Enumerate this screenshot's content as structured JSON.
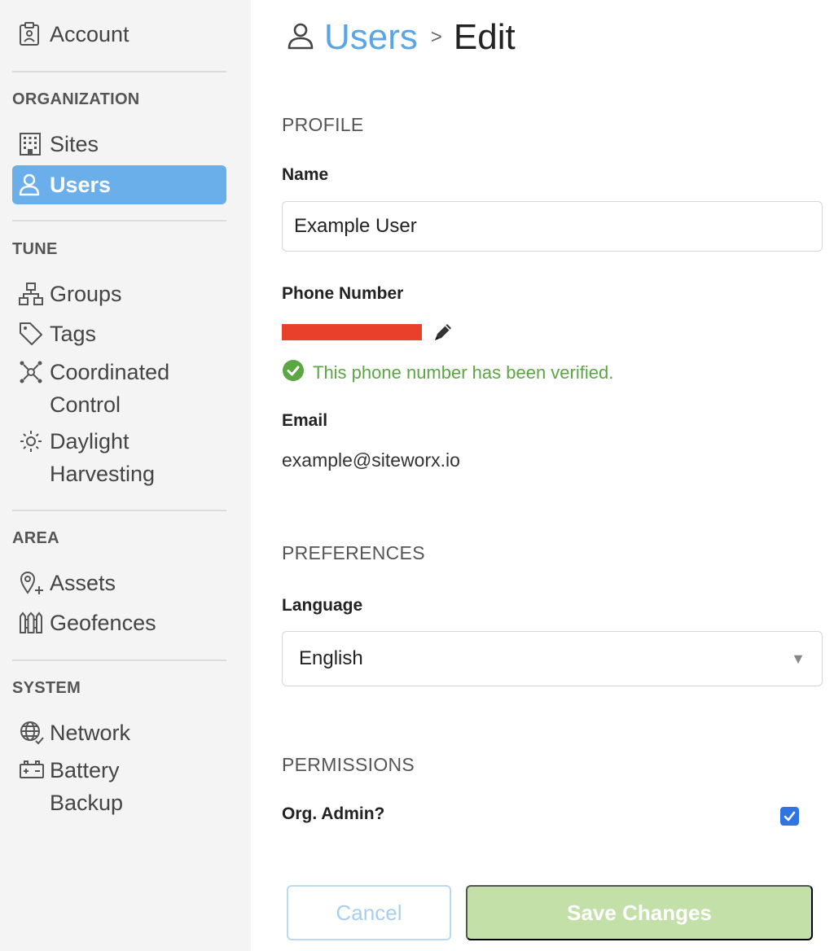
{
  "sidebar": {
    "account": {
      "label": "Account",
      "icon": "clipboard-user-icon"
    },
    "sections": {
      "organization": "ORGANIZATION",
      "tune": "TUNE",
      "area": "AREA",
      "system": "SYSTEM"
    },
    "items": {
      "sites": {
        "label": "Sites",
        "icon": "building-icon"
      },
      "users": {
        "label": "Users",
        "icon": "user-icon",
        "active": true
      },
      "groups": {
        "label": "Groups",
        "icon": "hierarchy-icon"
      },
      "tags": {
        "label": "Tags",
        "icon": "tag-icon"
      },
      "coordinated_control": {
        "label_line1": "Coordinated",
        "label_line2": "Control",
        "icon": "network-nodes-icon"
      },
      "daylight_harvesting": {
        "label_line1": "Daylight",
        "label_line2": "Harvesting",
        "icon": "sun-icon"
      },
      "assets": {
        "label": "Assets",
        "icon": "location-pin-plus-icon"
      },
      "geofences": {
        "label": "Geofences",
        "icon": "fence-icon"
      },
      "network": {
        "label": "Network",
        "icon": "globe-check-icon"
      },
      "battery_backup": {
        "label_line1": "Battery",
        "label_line2": "Backup",
        "icon": "battery-icon"
      }
    },
    "active_color": "#6aaeea"
  },
  "header": {
    "icon": "user-icon",
    "breadcrumb_link": "Users",
    "separator": ">",
    "current": "Edit"
  },
  "profile": {
    "section_title": "PROFILE",
    "name_label": "Name",
    "name_value": "Example User",
    "phone_label": "Phone Number",
    "phone_verified_text": "This phone number has been verified.",
    "email_label": "Email",
    "email_value": "example@siteworx.io"
  },
  "preferences": {
    "section_title": "PREFERENCES",
    "language_label": "Language",
    "language_value": "English"
  },
  "permissions": {
    "section_title": "PERMISSIONS",
    "org_admin_label": "Org. Admin?",
    "org_admin_checked": true
  },
  "actions": {
    "cancel_label": "Cancel",
    "save_label": "Save Changes"
  },
  "colors": {
    "link": "#5aa5e6",
    "verified": "#5aa743",
    "save_button": "#c3e0a8",
    "redaction": "#e8402a"
  }
}
